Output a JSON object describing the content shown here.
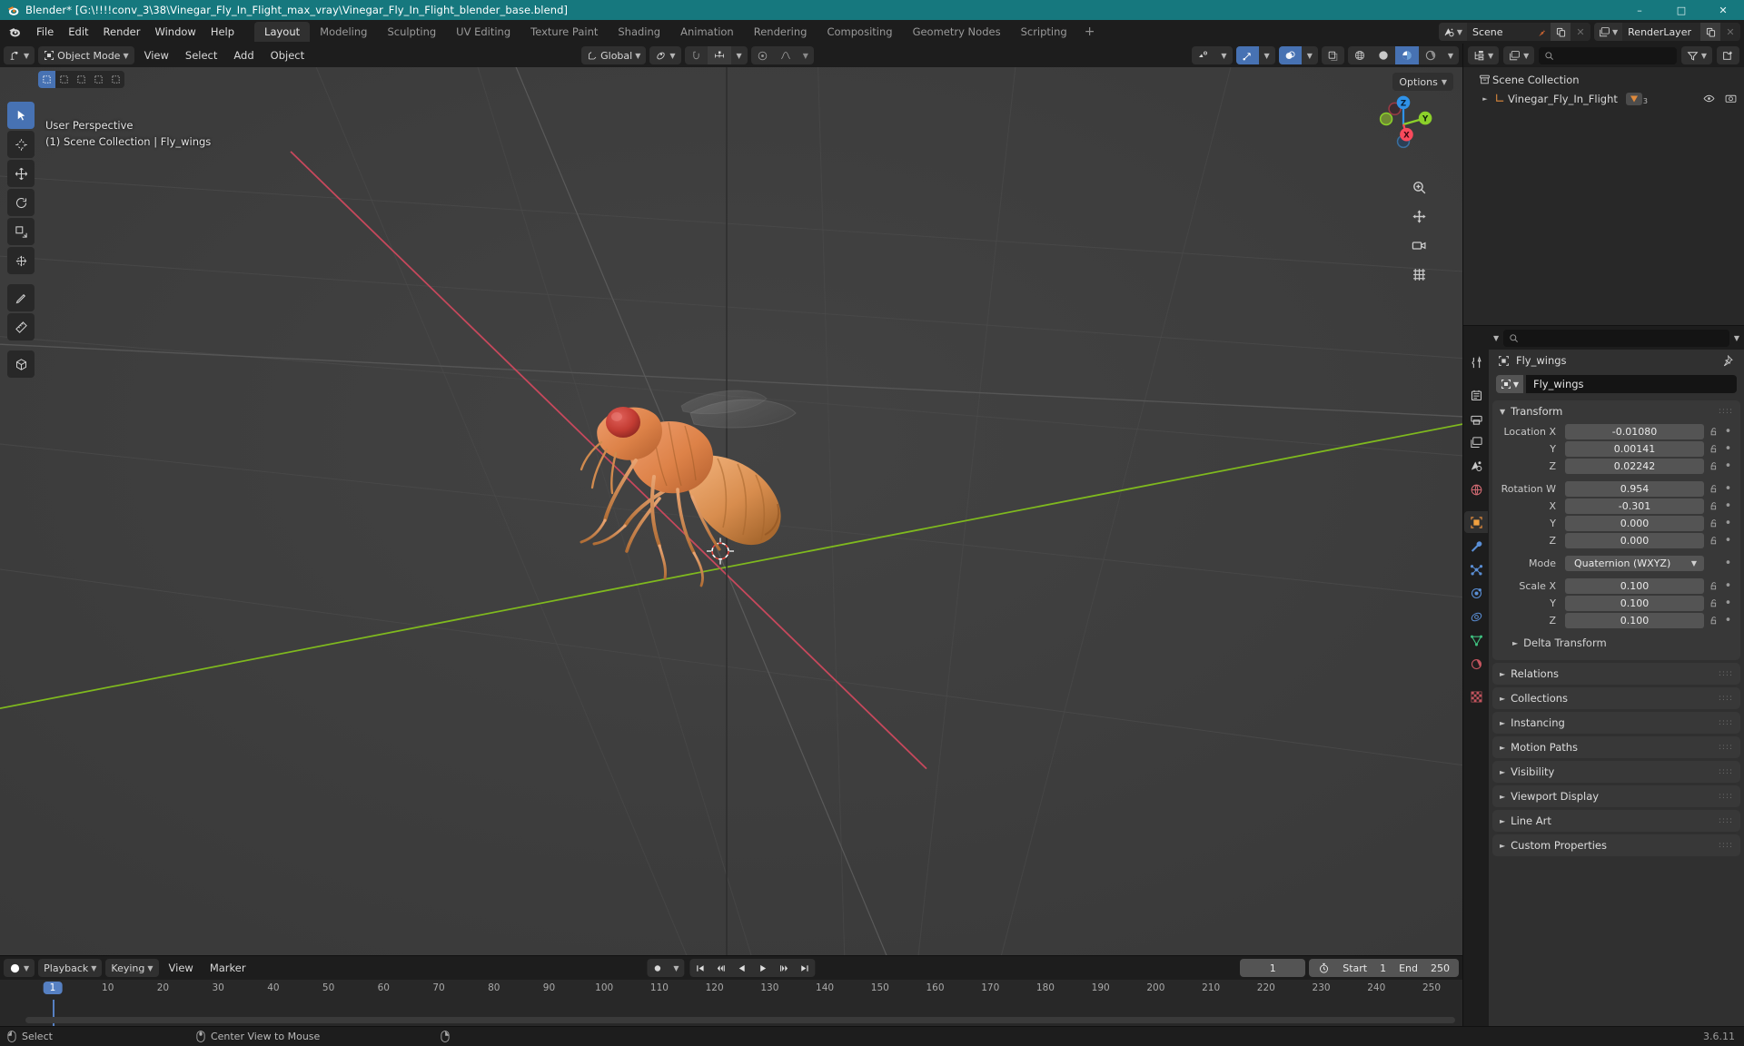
{
  "window": {
    "title": "Blender* [G:\\!!!!conv_3\\38\\Vinegar_Fly_In_Flight_max_vray\\Vinegar_Fly_In_Flight_blender_base.blend]",
    "app_icon": "blender-logo-icon",
    "minimize": "–",
    "maximize": "□",
    "close": "✕"
  },
  "topbar": {
    "menus": [
      "File",
      "Edit",
      "Render",
      "Window",
      "Help"
    ],
    "workspaces": [
      {
        "label": "Layout",
        "active": true
      },
      {
        "label": "Modeling",
        "active": false
      },
      {
        "label": "Sculpting",
        "active": false
      },
      {
        "label": "UV Editing",
        "active": false
      },
      {
        "label": "Texture Paint",
        "active": false
      },
      {
        "label": "Shading",
        "active": false
      },
      {
        "label": "Animation",
        "active": false
      },
      {
        "label": "Rendering",
        "active": false
      },
      {
        "label": "Compositing",
        "active": false
      },
      {
        "label": "Geometry Nodes",
        "active": false
      },
      {
        "label": "Scripting",
        "active": false
      }
    ],
    "add_workspace": "+",
    "scene": {
      "name": "Scene",
      "new_copy": "duplicate-icon",
      "unlink": "✕"
    },
    "view_layer": {
      "name": "RenderLayer",
      "new_copy": "duplicate-icon",
      "unlink": "✕"
    }
  },
  "viewport": {
    "header": {
      "editor_type": "editor-type-3dview",
      "mode": "Object Mode",
      "menus": [
        "View",
        "Select",
        "Add",
        "Object"
      ],
      "transform_orientation": "Global",
      "pivot": "pivot-icon",
      "snap_enabled": false,
      "proportional_editing": false
    },
    "overlay_text": {
      "perspective": "User Perspective",
      "scene_object": "(1) Scene Collection | Fly_wings"
    },
    "options_label": "Options",
    "gizmo_axes": [
      {
        "label": "X",
        "color": "#fa4a5c"
      },
      {
        "label": "Y",
        "color": "#8cd02a"
      },
      {
        "label": "Z",
        "color": "#2f92e8"
      }
    ],
    "tools": [
      {
        "name": "tweak-select-tool",
        "active": true
      },
      {
        "name": "cursor-tool",
        "active": false
      },
      {
        "name": "move-tool",
        "active": false
      },
      {
        "name": "rotate-tool",
        "active": false
      },
      {
        "name": "scale-tool",
        "active": false
      },
      {
        "name": "transform-tool",
        "active": false
      },
      {
        "name": "annotate-tool",
        "active": false
      },
      {
        "name": "measure-tool",
        "active": false
      },
      {
        "name": "add-cube-tool",
        "active": false
      }
    ],
    "shading_modes": [
      "wireframe",
      "solid",
      "material-preview",
      "rendered"
    ],
    "shading_active": "material-preview",
    "right_buttons": [
      "zoom-icon",
      "pan-icon",
      "camera-icon",
      "ortho-persp-icon"
    ],
    "select_mode_pills": [
      "tweak",
      "box",
      "circle",
      "lasso",
      "extend"
    ]
  },
  "outliner": {
    "display_mode": "View Layer",
    "filter_icon": "filter-icon",
    "new_collection_icon": "new-collection-icon",
    "search_placeholder": "",
    "rows": [
      {
        "name": "Scene Collection",
        "icon": "collection-icon",
        "indent": 0,
        "expandable": false,
        "selected": false
      },
      {
        "name": "Vinegar_Fly_In_Flight",
        "icon": "empty-axis-icon",
        "indent": 1,
        "expandable": true,
        "selected": false,
        "badge": "mesh-data-icon",
        "badge_count": "3",
        "eye": "visible-icon",
        "camera": "render-icon"
      }
    ]
  },
  "properties": {
    "tabs": [
      {
        "name": "tool",
        "active": false
      },
      {
        "name": "render",
        "active": false
      },
      {
        "name": "output",
        "active": false
      },
      {
        "name": "view-layer",
        "active": false
      },
      {
        "name": "scene",
        "active": false
      },
      {
        "name": "world",
        "active": false
      },
      {
        "name": "object",
        "active": true
      },
      {
        "name": "modifiers",
        "active": false
      },
      {
        "name": "particles",
        "active": false
      },
      {
        "name": "physics",
        "active": false
      },
      {
        "name": "constraints",
        "active": false
      },
      {
        "name": "object-data",
        "active": false
      },
      {
        "name": "material",
        "active": false
      },
      {
        "name": "texture",
        "active": false
      }
    ],
    "search_placeholder": "",
    "breadcrumb": "Fly_wings",
    "object_name": "Fly_wings",
    "pin_icon": "pin-icon",
    "transform": {
      "title": "Transform",
      "location": {
        "label": "Location X",
        "x": "-0.01080",
        "y": "0.00141",
        "z": "0.02242"
      },
      "rotation": {
        "label": "Rotation W",
        "w": "0.954",
        "x": "-0.301",
        "y": "0.000",
        "z": "0.000"
      },
      "mode_label": "Mode",
      "mode_value": "Quaternion (WXYZ)",
      "scale": {
        "label": "Scale X",
        "x": "0.100",
        "y": "0.100",
        "z": "0.100"
      },
      "axis_labels": {
        "x": "X",
        "y": "Y",
        "z": "Z",
        "w": "W"
      },
      "delta_transform": "Delta Transform"
    },
    "panels": [
      "Relations",
      "Collections",
      "Instancing",
      "Motion Paths",
      "Visibility",
      "Viewport Display",
      "Line Art",
      "Custom Properties"
    ]
  },
  "timeline": {
    "editor_icon": "timeline-editor-icon",
    "menus": [
      "Playback",
      "Keying",
      "View",
      "Marker"
    ],
    "record_icon": "record-icon",
    "transport": [
      "jump-start",
      "jump-prev-keyframe",
      "play-reverse",
      "play",
      "jump-next-keyframe",
      "jump-end"
    ],
    "current_frame": "1",
    "use_preview_range_icon": "stopwatch-icon",
    "start_label": "Start",
    "start_value": "1",
    "end_label": "End",
    "end_value": "250",
    "ruler_ticks": [
      "1",
      "10",
      "20",
      "30",
      "40",
      "50",
      "60",
      "70",
      "80",
      "90",
      "100",
      "110",
      "120",
      "130",
      "140",
      "150",
      "160",
      "170",
      "180",
      "190",
      "200",
      "210",
      "220",
      "230",
      "240",
      "250"
    ],
    "playhead_frame": "1"
  },
  "statusbar": {
    "items": [
      {
        "icon": "mouse-left-icon",
        "label": "Select"
      },
      {
        "icon": "mouse-middle-icon",
        "label": "Center View to Mouse"
      },
      {
        "icon": "mouse-right-icon",
        "label": ""
      }
    ],
    "version": "3.6.11"
  },
  "colors": {
    "title_bar": "#16787e",
    "accent_blue": "#4772b3",
    "axis_x": "#fa4a5c",
    "axis_y": "#8cd02a",
    "axis_z": "#2f92e8",
    "viewport_bg": "#3c3c3c",
    "panel_bg": "#383838",
    "editor_bg": "#303030",
    "header_bg": "#1d1d1d",
    "field_bg": "#545454",
    "fly_body": "#e08a55",
    "fly_eye": "#c03c33"
  }
}
